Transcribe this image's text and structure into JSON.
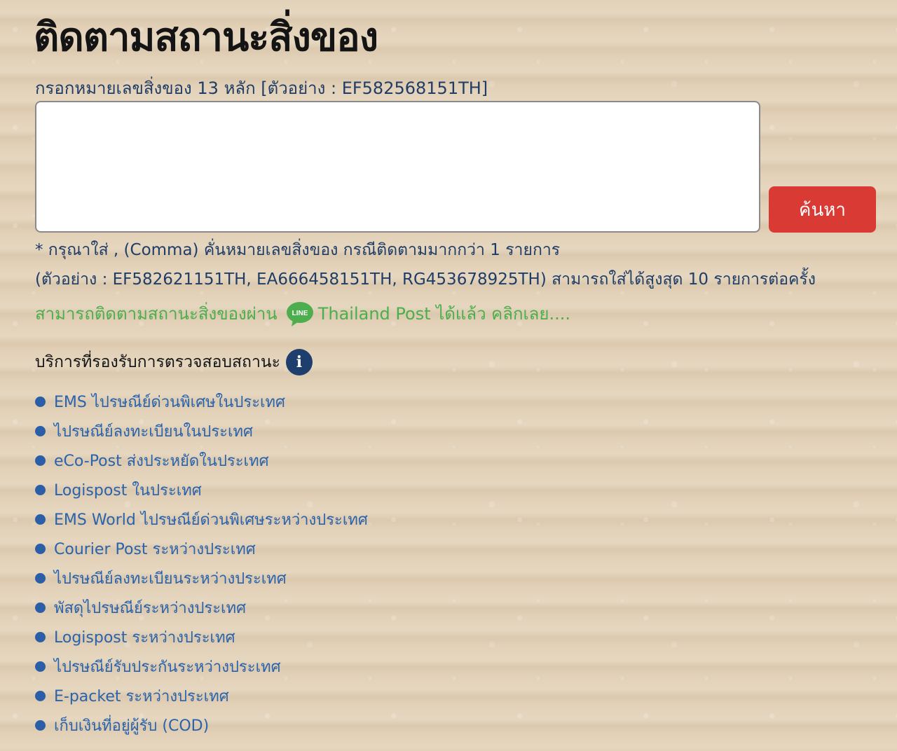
{
  "page": {
    "title": "ติดตามสถานะสิ่งของ",
    "input_label": "กรอกหมายเลขสิ่งของ 13 หลัก [ตัวอย่าง : EF582568151TH]",
    "input_value": "",
    "search_button": "ค้นหา",
    "hint_line_1": "* กรุณาใส่ , (Comma) คั่นหมายเลขสิ่งของ กรณีติดตามมากกว่า 1 รายการ",
    "hint_line_2": "(ตัวอย่าง : EF582621151TH, EA666458151TH, RG453678925TH) สามารถใส่ได้สูงสุด 10 รายการต่อครั้ง"
  },
  "line_promo": {
    "text_before": "สามารถติดตามสถานะสิ่งของผ่าน",
    "icon_name": "line-icon",
    "icon_text": "LINE",
    "text_after": "Thailand Post ได้แล้ว คลิกเลย....",
    "color": "#4cae4c"
  },
  "services": {
    "heading": "บริการที่รองรับการตรวจสอบสถานะ",
    "info_icon": "i",
    "items": [
      "EMS ไปรษณีย์ด่วนพิเศษในประเทศ",
      "ไปรษณีย์ลงทะเบียนในประเทศ",
      "eCo-Post ส่งประหยัดในประเทศ",
      "Logispost ในประเทศ",
      "EMS World ไปรษณีย์ด่วนพิเศษระหว่างประเทศ",
      "Courier Post ระหว่างประเทศ",
      "ไปรษณีย์ลงทะเบียนระหว่างประเทศ",
      "พัสดุไปรษณีย์ระหว่างประเทศ",
      "Logispost ระหว่างประเทศ",
      "ไปรษณีย์รับประกันระหว่างประเทศ",
      "E-packet ระหว่างประเทศ",
      "เก็บเงินที่อยู่ผู้รับ (COD)"
    ]
  },
  "colors": {
    "button": "#d93a34",
    "text_navy": "#1f3d66",
    "link_blue": "#2a63ad",
    "info_icon_bg": "#1e3f6e"
  }
}
